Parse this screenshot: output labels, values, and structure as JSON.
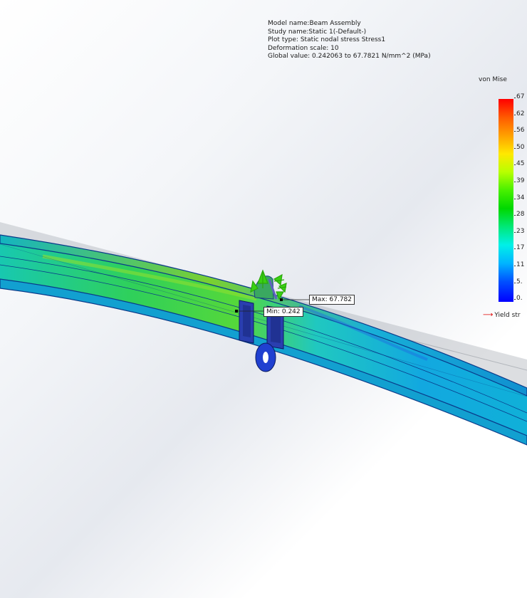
{
  "info": {
    "model_name": "Model name:Beam Assembly",
    "study_name": "Study name:Static 1(-Default-)",
    "plot_type": "Plot type: Static nodal stress Stress1",
    "deformation_scale": "Deformation scale: 10",
    "global_value": "Global value: 0.242063 to 67.7821 N/mm^2 (MPa)"
  },
  "legend": {
    "title": "von Mise",
    "ticks": [
      "67",
      "62",
      "56",
      "50",
      "45",
      "39",
      "34",
      "28",
      "23",
      "17",
      "11",
      "5.",
      "0."
    ],
    "yield_label": "Yield str"
  },
  "callouts": {
    "max": "Max: 67.782",
    "min": "Min: 0.242"
  },
  "colors": {
    "beam_edge": "#0a3a8a",
    "deformed_overlay": "#b0b4bb",
    "yield_arrow": "#e00000"
  }
}
